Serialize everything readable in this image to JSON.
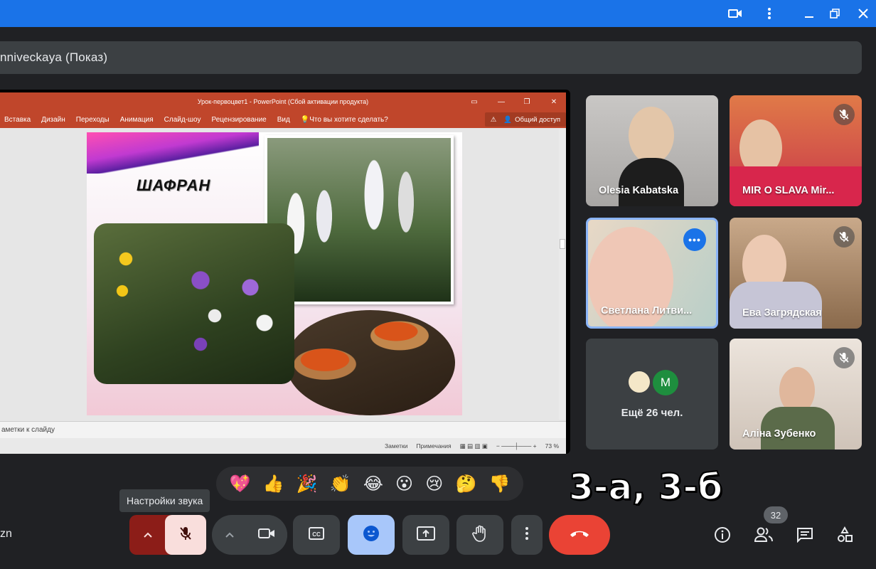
{
  "presenter": {
    "label": "nniveckaya (Показ)"
  },
  "ppt": {
    "window_title": "Урок-первоцвет1 - PowerPoint (Сбой активации продукта)",
    "ribbon": [
      "Вставка",
      "Дизайн",
      "Переходы",
      "Анимация",
      "Слайд-шоу",
      "Рецензирование",
      "Вид",
      "Что вы хотите сделать?"
    ],
    "share_label": "Общий доступ",
    "slide_title": "ШАФРАН",
    "notes_placeholder": "аметки к слайду",
    "status": {
      "notes": "Заметки",
      "comments": "Примечания",
      "zoom": "73 %"
    }
  },
  "participants": [
    {
      "name": "Olesia Kabatska",
      "muted": false,
      "bg": "#b9b6b4"
    },
    {
      "name": "MIR O SLAVA Mir...",
      "muted": true,
      "bg": "#d1563b"
    },
    {
      "name": "Светлана Литви...",
      "muted": false,
      "bg": "#c9d2cc",
      "active": true
    },
    {
      "name": "Ева Загрядская",
      "muted": true,
      "bg": "#c9a98a"
    },
    {
      "name": "Ещё 26 чел.",
      "avatar_letter": "M",
      "avatar_color": "#1e8e3e"
    },
    {
      "name": "Аліна Зубенко",
      "muted": true,
      "bg": "#d8cfc8"
    }
  ],
  "reactions": [
    "💖",
    "👍",
    "🎉",
    "👏",
    "😂",
    "😮",
    "😢",
    "🤔",
    "👎"
  ],
  "overlay_text": "3-а, 3-б",
  "tooltip": "Настройки звука",
  "meeting_code_partial": "zn",
  "participant_count": "32",
  "colors": {
    "accent": "#1a73e8",
    "end_call": "#ea4335",
    "mic_off_bg": "#f9dedc",
    "mic_off_arrow": "#8c1d18",
    "emoji_btn": "#a8c7fa"
  },
  "icons": [
    "video-icon",
    "more-vert-icon",
    "minimize-icon",
    "restore-icon",
    "close-icon",
    "mic-off-icon",
    "camera-icon",
    "captions-icon",
    "emoji-icon",
    "present-icon",
    "hand-icon",
    "call-end-icon",
    "info-icon",
    "people-icon",
    "chat-icon",
    "activities-icon"
  ]
}
